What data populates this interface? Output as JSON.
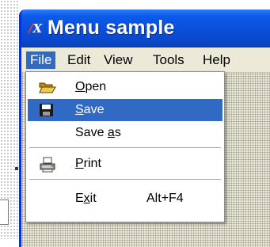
{
  "window": {
    "title": "Menu sample",
    "icon": "x-app-icon"
  },
  "menubar": {
    "items": [
      {
        "label": "File",
        "active": true
      },
      {
        "label": "Edit"
      },
      {
        "label": "View"
      },
      {
        "label": "Tools"
      },
      {
        "label": "Help"
      }
    ]
  },
  "file_menu": {
    "items": [
      {
        "pre": "",
        "mnemonic": "O",
        "post": "pen",
        "icon": "folder-open-icon"
      },
      {
        "pre": "",
        "mnemonic": "S",
        "post": "ave",
        "icon": "floppy-disk-icon",
        "selected": true
      },
      {
        "pre": "Save ",
        "mnemonic": "a",
        "post": "s"
      },
      {
        "pre": "",
        "mnemonic": "P",
        "post": "rint",
        "icon": "printer-icon"
      },
      {
        "pre": "E",
        "mnemonic": "x",
        "post": "it",
        "shortcut": "Alt+F4"
      }
    ]
  },
  "colors": {
    "titlebar": "#0a4fd8",
    "selection": "#316ac5",
    "window_bg": "#ece9d8"
  }
}
